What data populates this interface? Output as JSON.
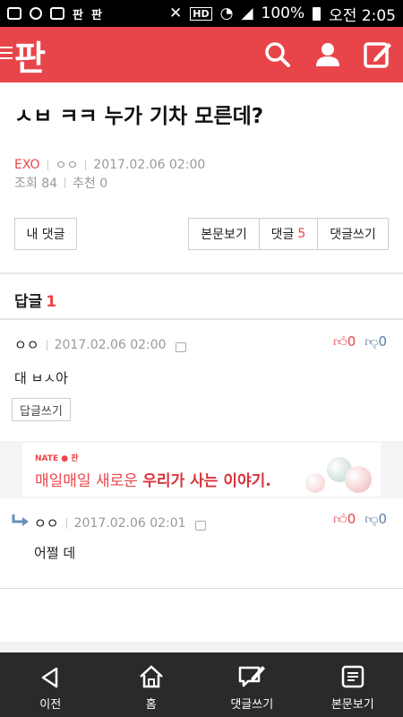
{
  "status_bar": {
    "hd_label": "HD",
    "battery": "100%",
    "time": "오전 2:05",
    "app_badges": [
      "판",
      "판"
    ]
  },
  "header": {
    "logo": "판",
    "icons": [
      "search-icon",
      "user-icon",
      "write-icon"
    ],
    "accent_color": "#e8454a"
  },
  "post": {
    "title": "ㅅㅂ ㅋㅋ 누가 기차 모른데?",
    "category": "EXO",
    "author": "ㅇㅇ",
    "date": "2017.02.06 02:00",
    "views": "조회 84",
    "recommends": "추천 0"
  },
  "actions": {
    "my_comments": "내 댓글",
    "view_post": "본문보기",
    "comments_label": "댓글",
    "comments_count": "5",
    "write_comment": "댓글쓰기"
  },
  "replies": {
    "label": "답글",
    "count": "1"
  },
  "comments": [
    {
      "author": "ㅇㅇ",
      "date": "2017.02.06 02:00",
      "upvotes": "0",
      "downvotes": "0",
      "body": "대 ㅂㅅ아",
      "reply_button": "답글쓰기"
    },
    {
      "author": "ㅇㅇ",
      "date": "2017.02.06 02:01",
      "upvotes": "0",
      "downvotes": "0",
      "body": "어쩔 데"
    }
  ],
  "ad": {
    "brand": "NATE ● 판",
    "text_plain": "매일매일 새로운 ",
    "text_bold": "우리가 사는 이야기."
  },
  "bottom_nav": [
    {
      "label": "이전",
      "icon": "back-icon"
    },
    {
      "label": "홈",
      "icon": "home-icon"
    },
    {
      "label": "댓글쓰기",
      "icon": "write-comment-icon"
    },
    {
      "label": "본문보기",
      "icon": "document-icon"
    }
  ]
}
